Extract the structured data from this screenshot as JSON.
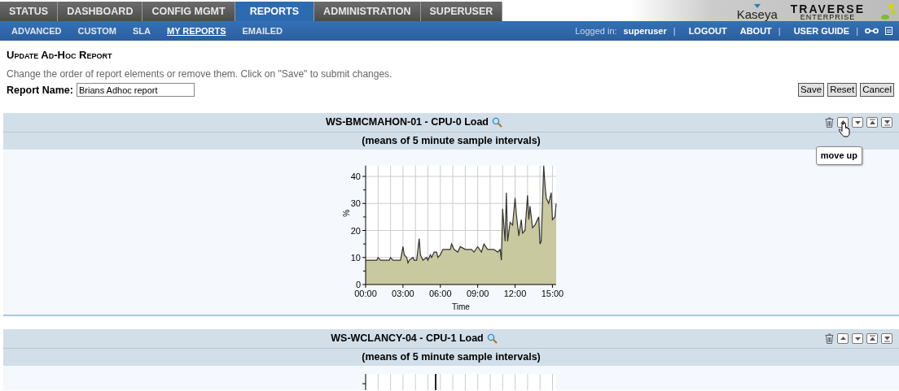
{
  "main_tabs": [
    {
      "label": "STATUS",
      "selected": false
    },
    {
      "label": "DASHBOARD",
      "selected": false
    },
    {
      "label": "CONFIG MGMT",
      "selected": false
    },
    {
      "label": "REPORTS",
      "selected": true
    },
    {
      "label": "ADMINISTRATION",
      "selected": false
    },
    {
      "label": "SUPERUSER",
      "selected": false
    }
  ],
  "logo": {
    "brand": "Kaseya",
    "product": "TRAVERSE",
    "edition": "ENTERPRISE"
  },
  "sub_nav": [
    {
      "label": "ADVANCED",
      "selected": false
    },
    {
      "label": "CUSTOM",
      "selected": false
    },
    {
      "label": "SLA",
      "selected": false
    },
    {
      "label": "MY REPORTS",
      "selected": true
    },
    {
      "label": "EMAILED",
      "selected": false
    }
  ],
  "user_bar": [
    {
      "kind": "label",
      "text": "Logged in:"
    },
    {
      "kind": "user",
      "text": "superuser"
    },
    {
      "kind": "sep",
      "text": "|"
    },
    {
      "kind": "link",
      "text": "LOGOUT"
    },
    {
      "kind": "link",
      "text": "ABOUT"
    },
    {
      "kind": "sep",
      "text": "|"
    },
    {
      "kind": "link",
      "text": "USER GUIDE"
    },
    {
      "kind": "sep",
      "text": "|"
    }
  ],
  "page": {
    "title": "Update Ad-Hoc Report",
    "description": "Change the order of report elements or remove them. Click on \"Save\" to submit changes.",
    "report_name_label": "Report Name:",
    "report_name": "Brians Adhoc report"
  },
  "buttons": [
    "Save",
    "Reset",
    "Cancel"
  ],
  "reports": [
    {
      "title": "WS-BMCMAHON-01 - CPU-0 Load",
      "subtitle": "(means of 5 minute sample intervals)",
      "tooltip": "move up",
      "chart_data": {
        "type": "area",
        "xlabel": "Time",
        "ylabel": "%",
        "xlim": [
          0,
          15.3
        ],
        "ylim": [
          0,
          44
        ],
        "xticks": [
          {
            "value": 0,
            "label": "00:00"
          },
          {
            "value": 3,
            "label": "03:00"
          },
          {
            "value": 6,
            "label": "06:00"
          },
          {
            "value": 9,
            "label": "09:00"
          },
          {
            "value": 12,
            "label": "12:00"
          },
          {
            "value": 15,
            "label": "15:00"
          }
        ],
        "yticks": [
          0,
          10,
          20,
          30,
          40
        ],
        "grid": true,
        "x": [
          0,
          0.9,
          1.0,
          1.2,
          1.9,
          2.0,
          2.2,
          2.8,
          3.0,
          3.1,
          3.3,
          3.4,
          3.5,
          3.8,
          3.9,
          4.1,
          4.3,
          4.4,
          4.6,
          4.9,
          5.0,
          5.2,
          5.3,
          5.5,
          5.7,
          5.8,
          6.0,
          6.2,
          6.8,
          6.9,
          7.1,
          7.4,
          7.6,
          8.0,
          8.5,
          8.7,
          9.0,
          9.3,
          9.5,
          9.8,
          10.3,
          10.6,
          10.8,
          10.9,
          11.0,
          11.1,
          11.2,
          11.3,
          11.4,
          11.6,
          11.8,
          12.0,
          12.1,
          12.3,
          12.5,
          12.6,
          12.8,
          13.0,
          13.1,
          13.2,
          13.4,
          13.6,
          13.9,
          14.0,
          14.1,
          14.3,
          14.4,
          14.5,
          14.7,
          14.9,
          15.0,
          15.2,
          15.3
        ],
        "series": [
          {
            "color": "#c9c9a0",
            "values": [
              9,
              9,
              10,
              9,
              9,
              10,
              9,
              9,
              14,
              11,
              10,
              8,
              9,
              10,
              9,
              9,
              17,
              11,
              9,
              10,
              9,
              11,
              10,
              12,
              12,
              10,
              11,
              13,
              13,
              15,
              13,
              12,
              14,
              13,
              13,
              12,
              14,
              12,
              15,
              13,
              13,
              12,
              13,
              9,
              28,
              22,
              16,
              34,
              16,
              23,
              22,
              32,
              26,
              18,
              24,
              19,
              20,
              33,
              24,
              29,
              21,
              22,
              25,
              15,
              16,
              44,
              37,
              32,
              30,
              34,
              24,
              25,
              30
            ]
          }
        ]
      }
    },
    {
      "title": "WS-WCLANCY-04 - CPU-1 Load",
      "subtitle": "(means of 5 minute sample intervals)"
    }
  ]
}
